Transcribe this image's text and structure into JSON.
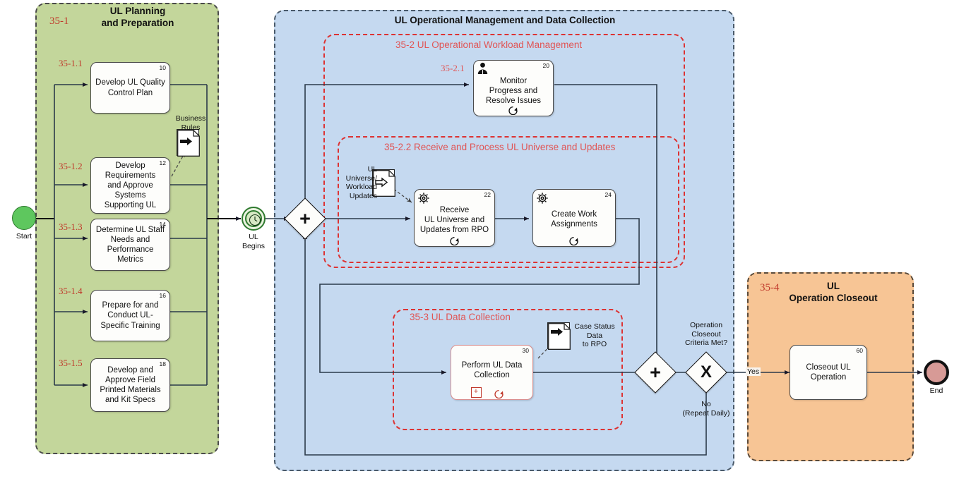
{
  "pools": {
    "planning": {
      "num": "35-1",
      "title": "UL Planning\nand Preparation",
      "color": "#c3d69b"
    },
    "operations": {
      "num": "",
      "title": "UL Operational Management and Data Collection",
      "color": "#c5d9f0"
    },
    "closeout": {
      "num": "35-4",
      "title": "UL\nOperation Closeout",
      "color": "#f7c595"
    }
  },
  "groups": {
    "workload": {
      "title": "35-2 UL Operational Workload Management"
    },
    "receive": {
      "title": "35-2.2 Receive and Process UL Universe and Updates"
    },
    "datacollection": {
      "title": "35-3  UL Data Collection"
    }
  },
  "events": {
    "start": {
      "label": "Start",
      "type": "start-event"
    },
    "ul_begins": {
      "label": "UL\nBegins",
      "type": "timer-event"
    },
    "end": {
      "label": "End",
      "type": "end-event"
    }
  },
  "gateways": {
    "split": {
      "symbol": "+",
      "label": "",
      "type": "parallel-gateway"
    },
    "join": {
      "symbol": "+",
      "label": "",
      "type": "parallel-gateway"
    },
    "decision": {
      "symbol": "X",
      "label": "Operation\nCloseout\nCriteria Met?",
      "type": "exclusive-gateway"
    }
  },
  "flow_labels": {
    "yes": "Yes",
    "no": "No\n(Repeat Daily)"
  },
  "tasks": [
    {
      "id": "t10",
      "step": "35-1.1",
      "num": "10",
      "label": "Develop UL Quality\nControl Plan",
      "markers": []
    },
    {
      "id": "t12",
      "step": "35-1.2",
      "num": "12",
      "label": "Develop\nRequirements\nand Approve\nSystems\nSupporting UL",
      "markers": []
    },
    {
      "id": "t14",
      "step": "35-1.3",
      "num": "14",
      "label": "Determine UL Staff\nNeeds and\nPerformance\nMetrics",
      "markers": []
    },
    {
      "id": "t16",
      "step": "35-1.4",
      "num": "16",
      "label": "Prepare for and\nConduct UL-\nSpecific Training",
      "markers": []
    },
    {
      "id": "t18",
      "step": "35-1.5",
      "num": "18",
      "label": "Develop and\nApprove Field\nPrinted Materials\nand Kit Specs",
      "markers": []
    },
    {
      "id": "t20",
      "step": "35-2.1",
      "num": "20",
      "label": "Monitor\nProgress and\nResolve Issues",
      "markers": [
        "user-icon",
        "loop-marker"
      ]
    },
    {
      "id": "t22",
      "step": "",
      "num": "22",
      "label": "Receive\nUL Universe and\nUpdates from RPO",
      "markers": [
        "gear-icon",
        "loop-marker"
      ]
    },
    {
      "id": "t24",
      "step": "",
      "num": "24",
      "label": "Create Work\nAssignments",
      "markers": [
        "gear-icon",
        "loop-marker"
      ]
    },
    {
      "id": "t30",
      "step": "",
      "num": "30",
      "label": "Perform UL Data\nCollection",
      "markers": [
        "subprocess-marker",
        "loop-marker"
      ]
    },
    {
      "id": "t60",
      "step": "",
      "num": "60",
      "label": "Closeout UL\nOperation",
      "markers": []
    }
  ],
  "documents": [
    {
      "id": "d_business_rules",
      "label": "Business\nRules",
      "icon": "document-output-icon"
    },
    {
      "id": "d_ul_universe",
      "label": "UL\nUniverse/\nWorkload\nUpdates",
      "icon": "document-input-icon"
    },
    {
      "id": "d_case_status",
      "label": "Case Status\nData\nto RPO",
      "icon": "document-output-icon"
    }
  ],
  "colors": {
    "green_pool": "#c3d69b",
    "blue_pool": "#c5d9f0",
    "orange_pool": "#f7c595",
    "group_red": "#dd3333",
    "number_red": "#c0392b",
    "start_green": "#5ec75e",
    "end_rose": "#d79a96"
  }
}
